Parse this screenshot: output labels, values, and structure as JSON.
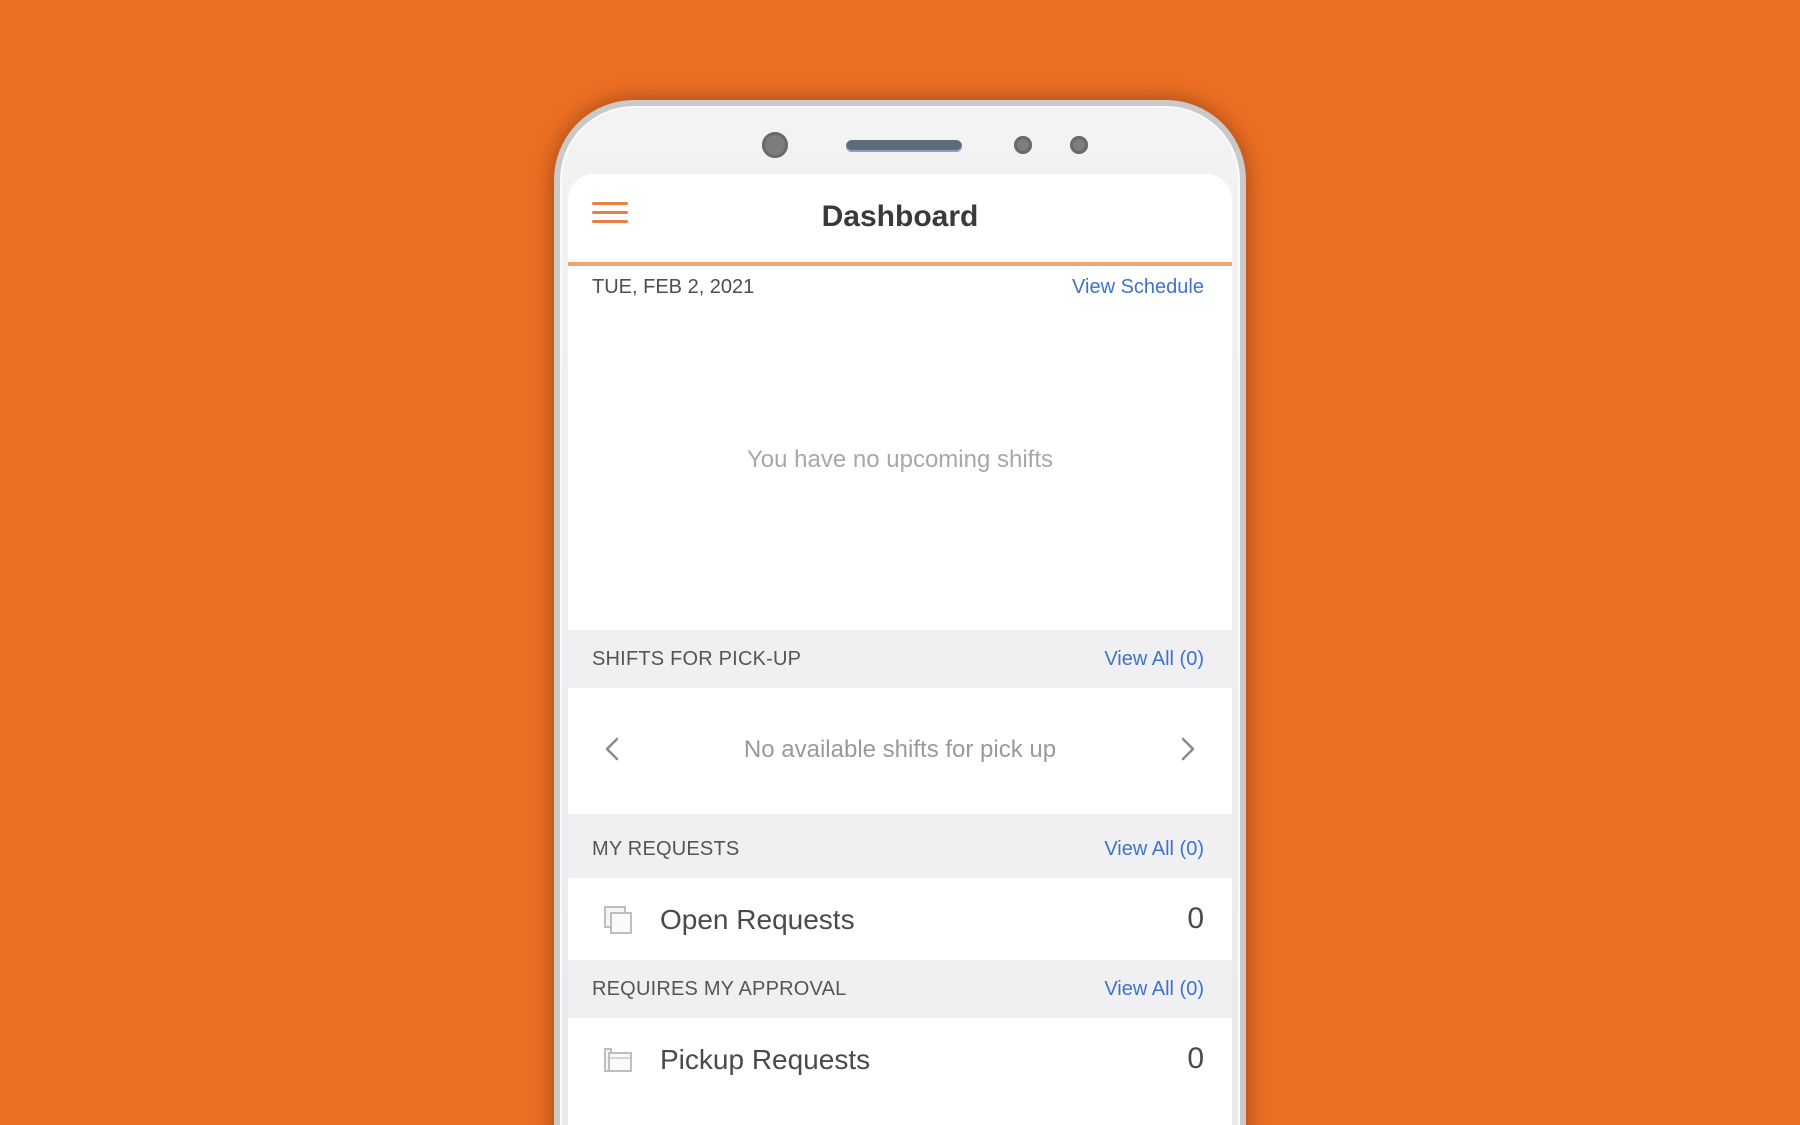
{
  "app": {
    "title": "Dashboard",
    "accent_color": "#ec6e23"
  },
  "date_header": {
    "date": "TUE, FEB 2, 2021",
    "link": "View Schedule"
  },
  "upcoming": {
    "empty_message": "You have no upcoming shifts"
  },
  "shifts_for_pickup": {
    "title": "SHIFTS FOR PICK-UP",
    "link": "View All (0)",
    "empty_message": "No available shifts for pick up",
    "prev_icon": "chevron-left-icon",
    "next_icon": "chevron-right-icon"
  },
  "my_requests": {
    "title": "MY REQUESTS",
    "link": "View All (0)",
    "items": [
      {
        "label": "Open Requests",
        "count": "0",
        "icon": "stacked-pages-icon"
      }
    ]
  },
  "requires_my_approval": {
    "title": "REQUIRES MY APPROVAL",
    "link": "View All (0)",
    "items": [
      {
        "label": "Pickup Requests",
        "count": "0",
        "icon": "inbox-icon"
      }
    ]
  }
}
